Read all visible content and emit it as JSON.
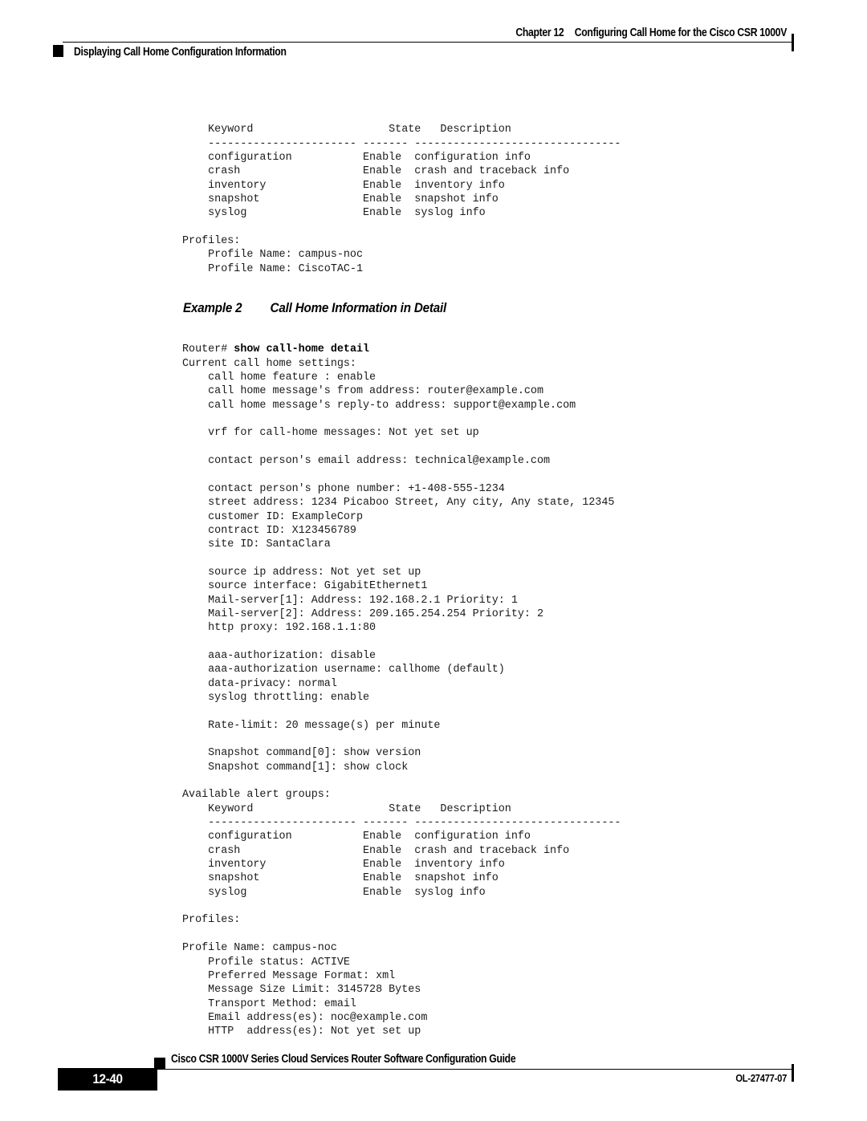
{
  "header": {
    "chapter_label": "Chapter 12",
    "chapter_title": "Configuring Call Home for the Cisco CSR 1000V",
    "section_title": "Displaying Call Home Configuration Information"
  },
  "footer": {
    "page_number": "12-40",
    "guide_title": "Cisco CSR 1000V Series Cloud Services Router Software Configuration Guide",
    "doc_id": "OL-27477-07"
  },
  "example": {
    "number_label": "Example 2",
    "title": "Call Home Information in Detail"
  },
  "code_top": {
    "lines": [
      "    Keyword                     State   Description",
      "    ----------------------- ------- --------------------------------",
      "    configuration           Enable  configuration info",
      "    crash                   Enable  crash and traceback info",
      "    inventory               Enable  inventory info",
      "    snapshot                Enable  snapshot info",
      "    syslog                  Enable  syslog info",
      "",
      "Profiles:",
      "    Profile Name: campus-noc",
      "    Profile Name: CiscoTAC-1"
    ]
  },
  "code_detail": {
    "prompt": "Router# ",
    "command": "show call-home detail",
    "lines": [
      "Current call home settings:",
      "    call home feature : enable",
      "    call home message's from address: router@example.com",
      "    call home message's reply-to address: support@example.com",
      "",
      "    vrf for call-home messages: Not yet set up",
      "",
      "    contact person's email address: technical@example.com",
      "",
      "    contact person's phone number: +1-408-555-1234",
      "    street address: 1234 Picaboo Street, Any city, Any state, 12345",
      "    customer ID: ExampleCorp",
      "    contract ID: X123456789",
      "    site ID: SantaClara",
      "",
      "    source ip address: Not yet set up",
      "    source interface: GigabitEthernet1",
      "    Mail-server[1]: Address: 192.168.2.1 Priority: 1",
      "    Mail-server[2]: Address: 209.165.254.254 Priority: 2",
      "    http proxy: 192.168.1.1:80",
      "",
      "    aaa-authorization: disable",
      "    aaa-authorization username: callhome (default)",
      "    data-privacy: normal",
      "    syslog throttling: enable",
      "",
      "    Rate-limit: 20 message(s) per minute",
      "",
      "    Snapshot command[0]: show version",
      "    Snapshot command[1]: show clock",
      "",
      "Available alert groups:",
      "    Keyword                     State   Description",
      "    ----------------------- ------- --------------------------------",
      "    configuration           Enable  configuration info",
      "    crash                   Enable  crash and traceback info",
      "    inventory               Enable  inventory info",
      "    snapshot                Enable  snapshot info",
      "    syslog                  Enable  syslog info",
      "",
      "Profiles:",
      "",
      "Profile Name: campus-noc",
      "    Profile status: ACTIVE",
      "    Preferred Message Format: xml",
      "    Message Size Limit: 3145728 Bytes",
      "    Transport Method: email",
      "    Email address(es): noc@example.com",
      "    HTTP  address(es): Not yet set up"
    ]
  }
}
